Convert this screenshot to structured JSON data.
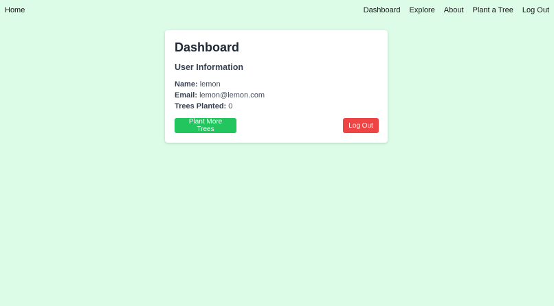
{
  "nav": {
    "home": "Home",
    "links": [
      "Dashboard",
      "Explore",
      "About",
      "Plant a Tree",
      "Log Out"
    ]
  },
  "card": {
    "title": "Dashboard",
    "subtitle": "User Information",
    "name_label": "Name:",
    "name_value": "lemon",
    "email_label": "Email:",
    "email_value": "lemon@lemon.com",
    "trees_label": "Trees Planted:",
    "trees_value": "0",
    "plant_button": "Plant More Trees",
    "logout_button": "Log Out"
  },
  "colors": {
    "background": "#dcfce7",
    "primary_button": "#22c55e",
    "danger_button": "#ef4444"
  }
}
